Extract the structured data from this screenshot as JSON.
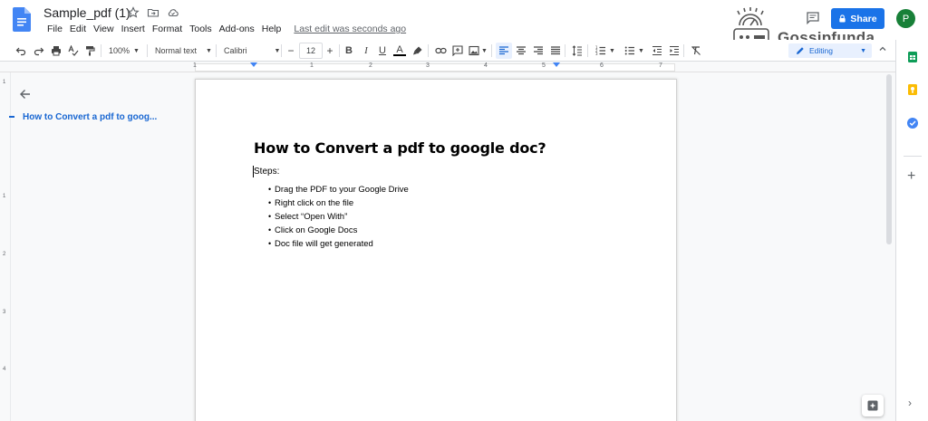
{
  "header": {
    "title": "Sample_pdf (1)",
    "menu": [
      "File",
      "Edit",
      "View",
      "Insert",
      "Format",
      "Tools",
      "Add-ons",
      "Help"
    ],
    "last_edit": "Last edit was seconds ago",
    "share_label": "Share",
    "avatar_initial": "P"
  },
  "watermark": {
    "text": "Gossipfunda"
  },
  "toolbar": {
    "zoom": "100%",
    "style": "Normal text",
    "font": "Calibri",
    "font_size": "12",
    "bold": "B",
    "italic": "I",
    "underline": "U",
    "text_color": "A",
    "mode": "Editing"
  },
  "ruler": {
    "numbers": [
      "1",
      "1",
      "2",
      "3",
      "4",
      "5",
      "6",
      "7"
    ]
  },
  "vruler": {
    "numbers": [
      "1",
      "1",
      "2",
      "3",
      "4"
    ]
  },
  "outline": {
    "items": [
      "How to Convert a pdf to goog..."
    ]
  },
  "document": {
    "title": "How to Convert a pdf to google doc?",
    "steps_label": "Steps:",
    "bullets": [
      "Drag the PDF to your Google Drive",
      "Right click on the file",
      "Select “Open With”",
      "Click on Google Docs",
      "Doc file will get generated"
    ]
  },
  "colors": {
    "accent": "#1a73e8",
    "avatar": "#188038",
    "link": "#1967d2"
  }
}
